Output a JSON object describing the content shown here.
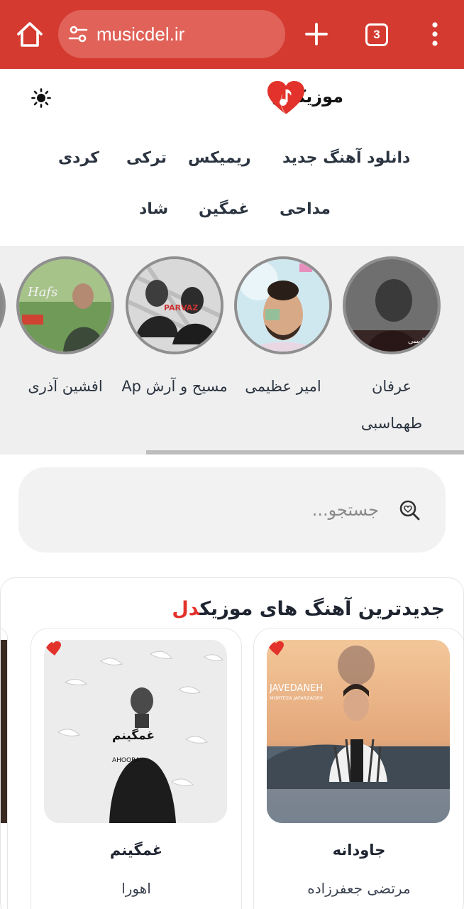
{
  "browser": {
    "url": "musicdel.ir",
    "tab_count": "3",
    "toolbar_color": "#d43a30"
  },
  "site": {
    "brand": "موزیکدل",
    "accent_color": "#e2322b",
    "nav": [
      "دانلود آهنگ جدید",
      "ریمیکس",
      "ترکی",
      "کردی",
      "مداحی",
      "غمگین",
      "شاد"
    ]
  },
  "stories": [
    {
      "name": "عرفان طهماسبی"
    },
    {
      "name": "امیر عظیمی"
    },
    {
      "name": "مسیح و آرش Ap"
    },
    {
      "name": "افشین آذری"
    }
  ],
  "search": {
    "placeholder": "جستجو..."
  },
  "latest": {
    "title_main": "جدیدترین آهنگ های موزیک",
    "title_accent": "دل",
    "songs": [
      {
        "title": "جاودانه",
        "artist": "مرتضی جعفرزاده",
        "cover_text": "JAVEDANEH",
        "cover_sub": "MORTEZA JAFARZADEH"
      },
      {
        "title": "غمگینم",
        "artist": "اهورا",
        "cover_text": "غمگینم",
        "cover_sub": "AHOORA"
      }
    ]
  },
  "icons": {
    "home": "home-icon",
    "site_info": "tune-icon",
    "new_tab": "plus-icon",
    "menu": "more-vert-icon",
    "theme": "sun-icon",
    "search": "search-heart-icon"
  }
}
